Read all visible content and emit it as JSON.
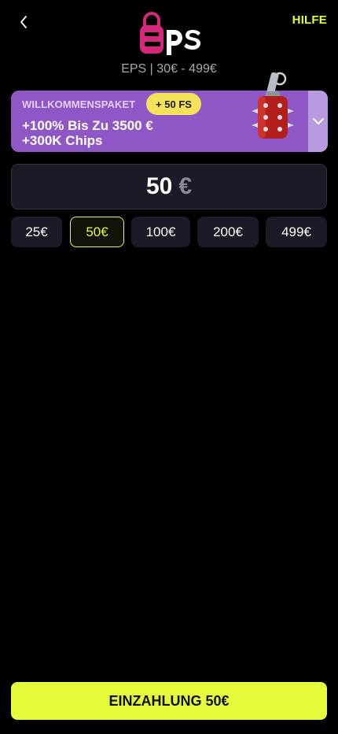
{
  "header": {
    "back_icon": "chevron-left-icon",
    "help_label": "HILFE",
    "logo_text": "eps",
    "subtitle": "EPS | 30€ - 499€"
  },
  "promo": {
    "label": "WILLKOMMENSPAKET",
    "badge": "+ 50 FS",
    "line1": "+100% Bis Zu 3500 €",
    "line2": "+300K Chips",
    "expand_icon": "chevron-down-icon",
    "image_icon": "grenade-icon"
  },
  "amount": {
    "value": "50",
    "currency": "€"
  },
  "presets": [
    "25€",
    "50€",
    "100€",
    "200€",
    "499€"
  ],
  "selected_preset": "50€",
  "deposit": {
    "label": "EINZAHLUNG 50€"
  },
  "colors": {
    "accent": "#e6fb3c",
    "promo_bg": "#8f57c6",
    "logo_pink": "#d6287a",
    "background": "#000000"
  }
}
